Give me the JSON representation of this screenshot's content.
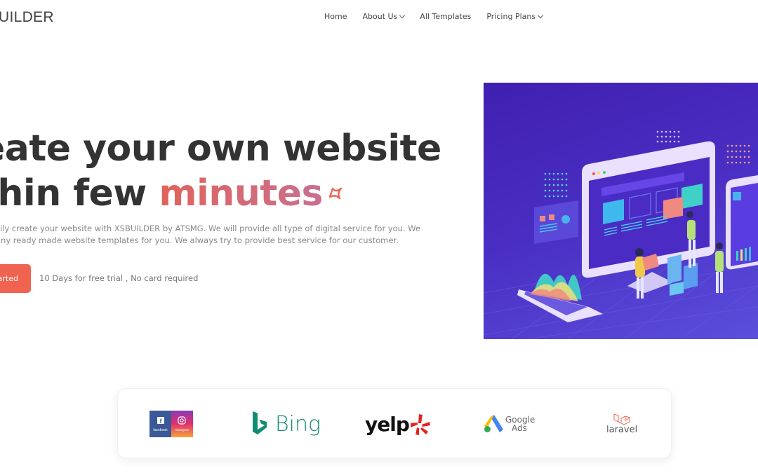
{
  "header": {
    "logo_text": "UILDER",
    "nav": [
      {
        "label": "Home",
        "dropdown": false
      },
      {
        "label": "About Us",
        "dropdown": true
      },
      {
        "label": "All Templates",
        "dropdown": false
      },
      {
        "label": "Pricing Plans",
        "dropdown": true
      }
    ]
  },
  "hero": {
    "title_line1": "eate your own website",
    "title_line2_prefix": "thin few ",
    "title_line2_accent": "minutes",
    "description_line1": "sily create your website with XSBUILDER by ATSMG. We will provide all type of digital service for you. We",
    "description_line2": "any ready made website templates for you. We always try to provide best service for our customer.",
    "cta_label": "arted",
    "trial_note": "10 Days for free trial , No card required",
    "accent_color": "#ef6350",
    "illustration": "website-builder-isometric-illustration"
  },
  "partners": {
    "logos": [
      {
        "name": "facebook-instagram",
        "labels": [
          "facebook",
          "Instagram"
        ]
      },
      {
        "name": "bing",
        "label": "Bing"
      },
      {
        "name": "yelp",
        "label": "yelp"
      },
      {
        "name": "google-ads",
        "label_line1": "Google",
        "label_line2": "Ads"
      },
      {
        "name": "laravel",
        "label": "laravel"
      }
    ]
  }
}
